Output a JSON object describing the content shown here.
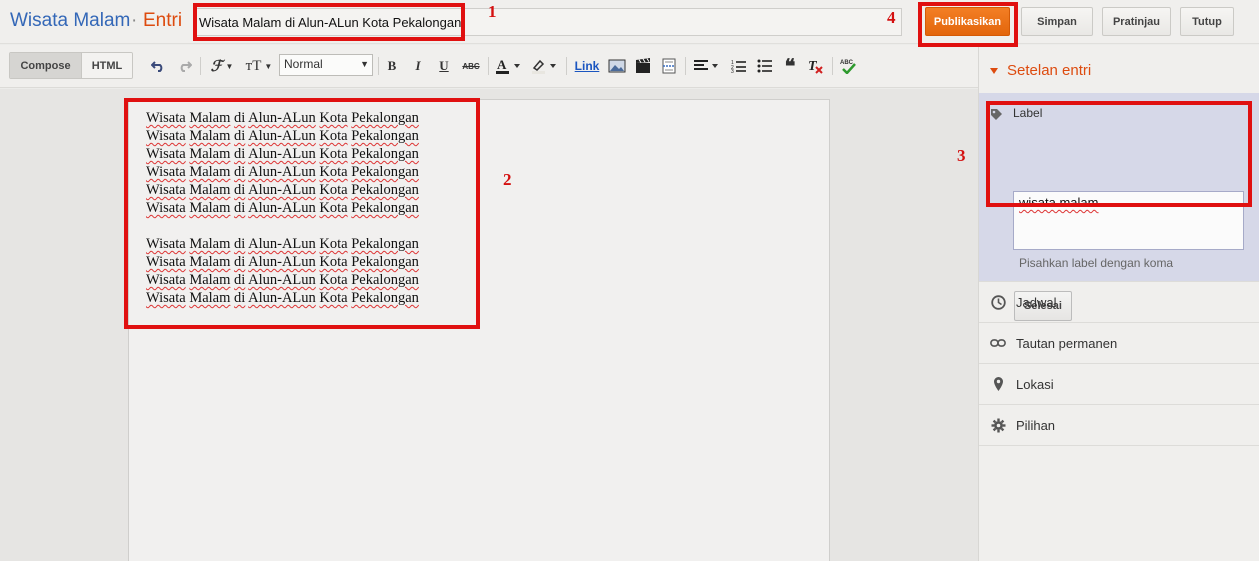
{
  "header": {
    "blog_title": "Wisata Malam",
    "separator": "·",
    "page_type": "Entri",
    "post_title": "Wisata Malam di Alun-ALun Kota Pekalongan",
    "buttons": {
      "publish": "Publikasikan",
      "save": "Simpan",
      "preview": "Pratinjau",
      "close": "Tutup"
    }
  },
  "toolbar": {
    "compose": "Compose",
    "html": "HTML",
    "font_size": "Normal",
    "bold": "B",
    "italic": "I",
    "underline": "U",
    "strike": "ABC",
    "link": "Link"
  },
  "editor": {
    "lines_block_1": [
      "Wisata Malam di Alun-ALun Kota Pekalongan",
      "Wisata Malam di Alun-ALun Kota Pekalongan",
      "Wisata Malam di Alun-ALun Kota Pekalongan",
      "Wisata Malam di Alun-ALun Kota Pekalongan",
      "Wisata Malam di Alun-ALun Kota Pekalongan",
      "Wisata Malam di Alun-ALun Kota Pekalongan"
    ],
    "lines_block_2": [
      "Wisata Malam di Alun-ALun Kota Pekalongan",
      "Wisata Malam di Alun-ALun Kota Pekalongan",
      "Wisata Malam di Alun-ALun Kota Pekalongan",
      "Wisata Malam di Alun-ALun Kota Pekalongan"
    ]
  },
  "sidebar": {
    "heading": "Setelan entri",
    "label_section": {
      "title": "Label",
      "value": "wisata malam",
      "hint": "Pisahkan label dengan koma",
      "done": "Selesai"
    },
    "items": [
      {
        "label": "Jadwal",
        "icon": "clock-icon"
      },
      {
        "label": "Tautan permanen",
        "icon": "link-icon"
      },
      {
        "label": "Lokasi",
        "icon": "map-pin-icon"
      },
      {
        "label": "Pilihan",
        "icon": "gear-icon"
      }
    ]
  },
  "annotations": {
    "n1": "1",
    "n2": "2",
    "n3": "3",
    "n4": "4"
  },
  "colors": {
    "accent_orange": "#dd4b0f",
    "brand_blue": "#3367b7",
    "annotation_red": "#e01010"
  }
}
